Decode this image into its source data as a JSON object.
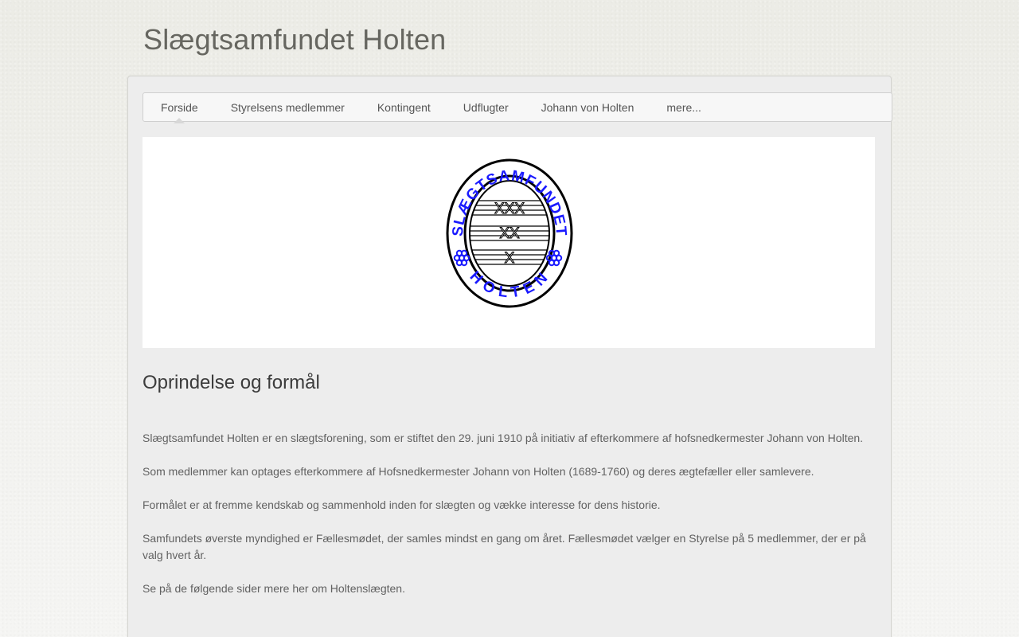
{
  "site": {
    "title": "Slægtsamfundet Holten"
  },
  "nav": {
    "items": [
      {
        "label": "Forside",
        "active": true
      },
      {
        "label": "Styrelsens medlemmer"
      },
      {
        "label": "Kontingent"
      },
      {
        "label": "Udflugter"
      },
      {
        "label": "Johann von Holten"
      },
      {
        "label": "mere..."
      }
    ]
  },
  "logo": {
    "top_text": "SLÆGTSAMFUNDET",
    "bottom_text": "HOLTEN",
    "marks": [
      "XXX",
      "XX",
      "X"
    ],
    "color": "#1a1aff"
  },
  "content": {
    "heading": "Oprindelse og formål",
    "paragraphs": [
      "Slægtsamfundet Holten er en slægtsforening, som er stiftet den 29. juni 1910 på initiativ af efterkommere af hofsnedkermester Johann von Holten.",
      "Som medlemmer kan optages efterkommere af Hofsnedkermester Johann von Holten (1689-1760) og deres ægtefæller eller samlevere.",
      "Formålet er at fremme kendskab og sammenhold inden for slægten og vække interesse for dens historie.",
      "Samfundets øverste myndighed er Fællesmødet, der samles mindst en gang om året. Fællesmødet vælger en Styrelse på 5 medlemmer, der er på valg hvert år.",
      "Se på de følgende sider mere her om Holtenslægten."
    ]
  }
}
